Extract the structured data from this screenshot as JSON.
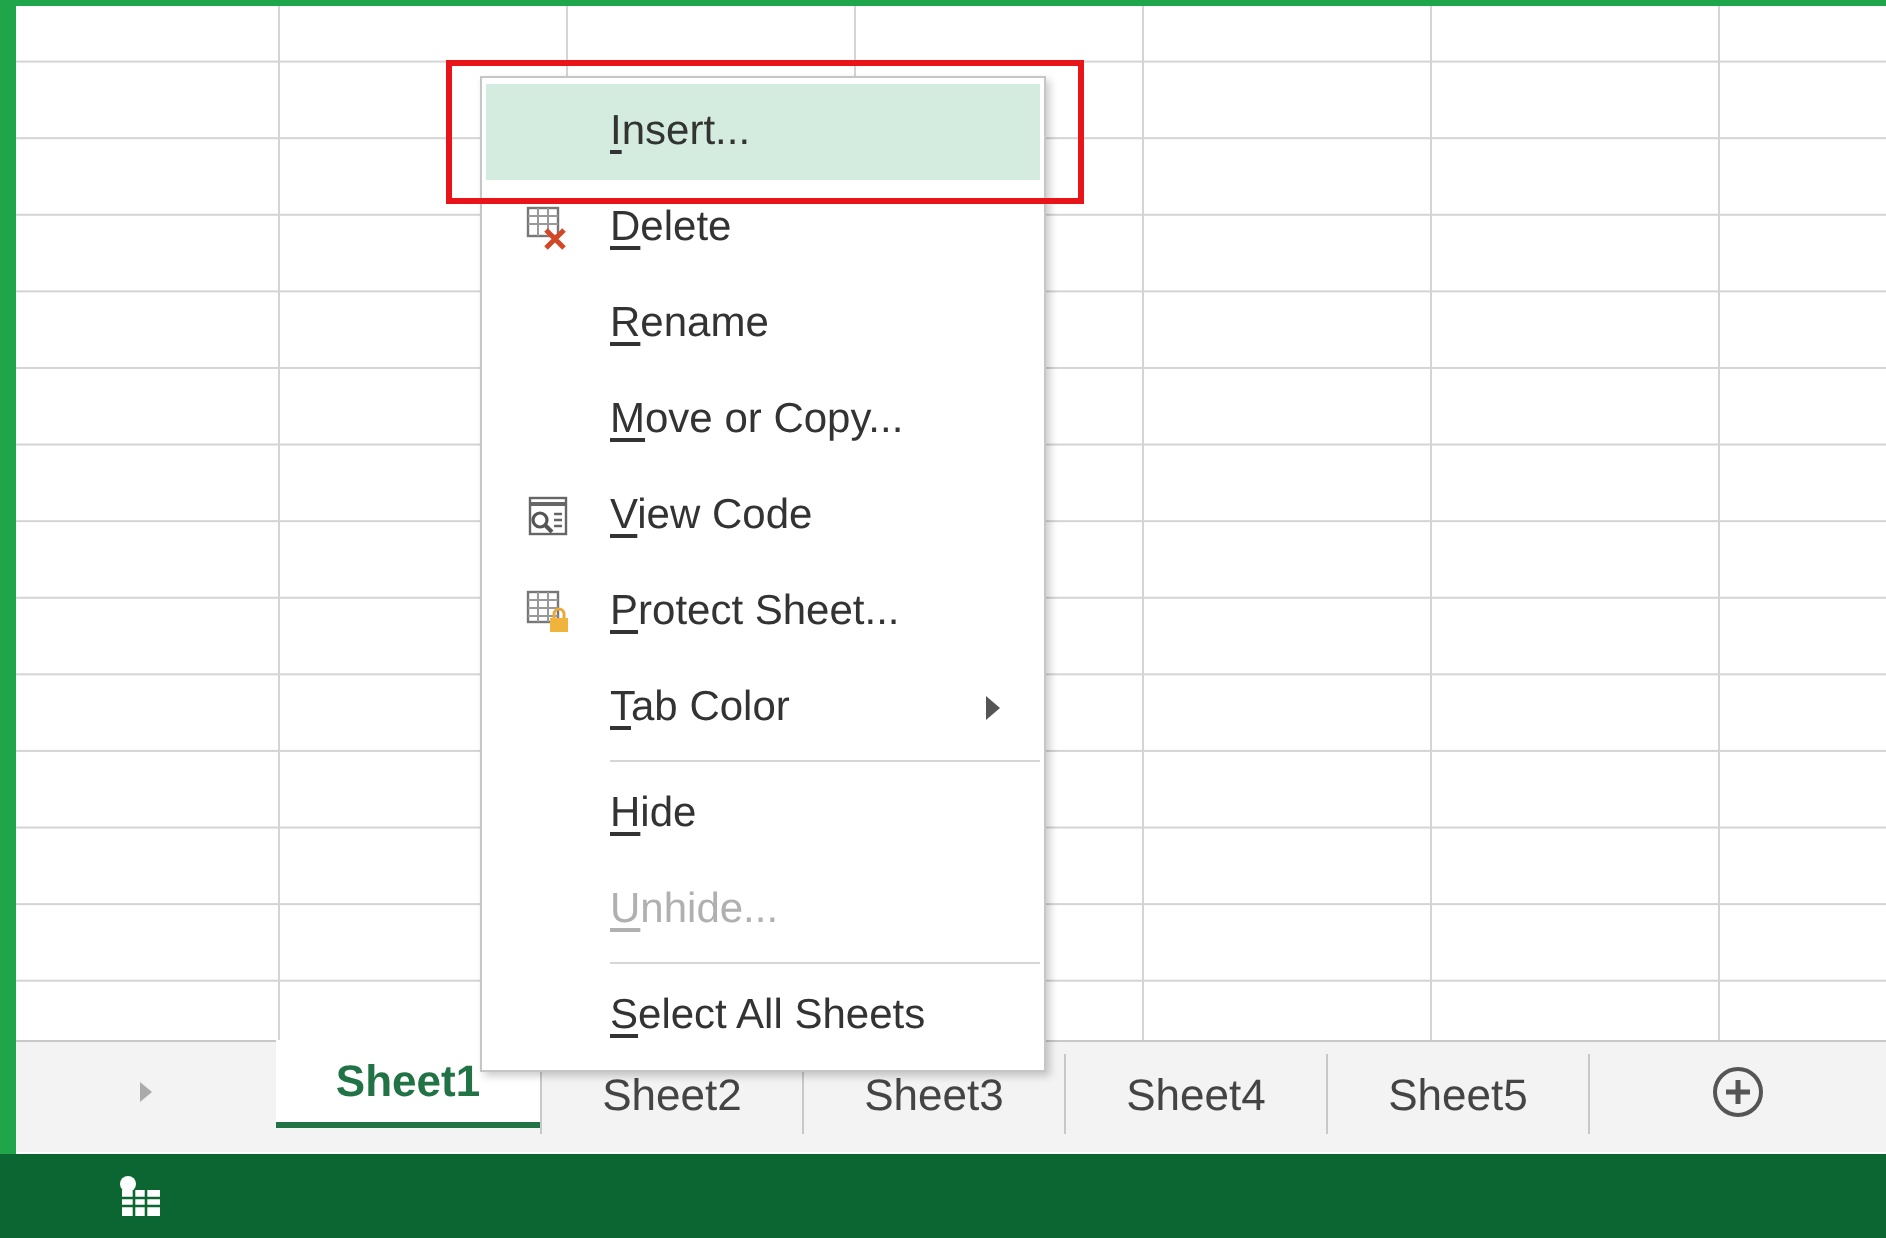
{
  "context_menu": {
    "items": [
      {
        "kind": "plain",
        "label": "Insert...",
        "selected": true,
        "disabled": false,
        "submenu": false
      },
      {
        "kind": "delete",
        "label": "Delete",
        "selected": false,
        "disabled": false,
        "submenu": false
      },
      {
        "kind": "plain",
        "label": "Rename",
        "selected": false,
        "disabled": false,
        "submenu": false
      },
      {
        "kind": "plain",
        "label": "Move or Copy...",
        "selected": false,
        "disabled": false,
        "submenu": false
      },
      {
        "kind": "code",
        "label": "View Code",
        "selected": false,
        "disabled": false,
        "submenu": false
      },
      {
        "kind": "protect",
        "label": "Protect Sheet...",
        "selected": false,
        "disabled": false,
        "submenu": false
      },
      {
        "kind": "plain",
        "label": "Tab Color",
        "selected": false,
        "disabled": false,
        "submenu": true
      },
      {
        "kind": "separator"
      },
      {
        "kind": "plain",
        "label": "Hide",
        "selected": false,
        "disabled": false,
        "submenu": false
      },
      {
        "kind": "plain",
        "label": "Unhide...",
        "selected": false,
        "disabled": true,
        "submenu": false
      },
      {
        "kind": "separator"
      },
      {
        "kind": "plain",
        "label": "Select All Sheets",
        "selected": false,
        "disabled": false,
        "submenu": false
      }
    ]
  },
  "sheet_tabs": [
    {
      "label": "Sheet1",
      "selected": true
    },
    {
      "label": "Sheet2",
      "selected": false
    },
    {
      "label": "Sheet3",
      "selected": false
    },
    {
      "label": "Sheet4",
      "selected": false
    },
    {
      "label": "Sheet5",
      "selected": false
    }
  ]
}
